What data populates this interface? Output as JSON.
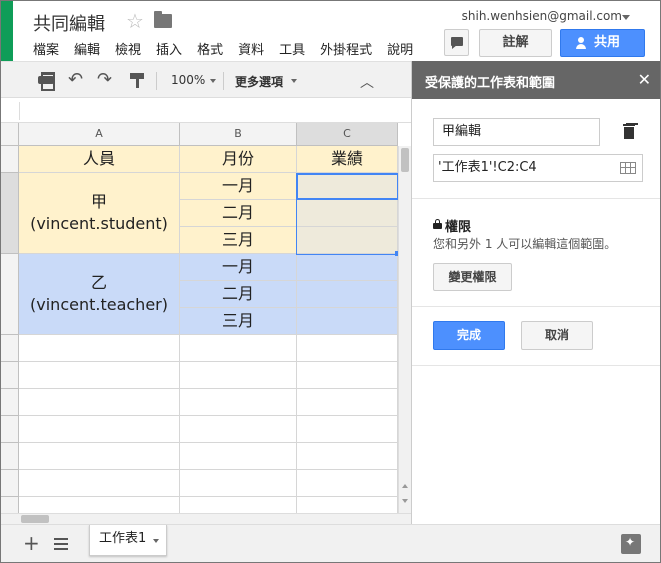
{
  "header": {
    "title": "共同編輯",
    "account": "shih.wenhsien@gmail.com",
    "menu": [
      "檔案",
      "編輯",
      "檢視",
      "插入",
      "格式",
      "資料",
      "工具",
      "外掛程式",
      "說明"
    ],
    "notes_label": "註解",
    "share_label": "共用"
  },
  "toolbar": {
    "zoom": "100%",
    "more": "更多選項"
  },
  "sheet": {
    "columns": [
      "A",
      "B",
      "C"
    ],
    "header_row": [
      "人員",
      "月份",
      "業績"
    ],
    "group1_person": [
      "甲",
      "(vincent.student)"
    ],
    "group2_person": [
      "乙",
      "(vincent.teacher)"
    ],
    "months": [
      "一月",
      "二月",
      "三月"
    ],
    "colors": {
      "group1": "#fff2cc",
      "group2": "#c9daf8",
      "selection": "#4285f4"
    }
  },
  "sheetbar": {
    "tab_label": "工作表1"
  },
  "panel": {
    "title": "受保護的工作表和範圍",
    "description": "甲編輯",
    "range": "'工作表1'!C2:C4",
    "permissions_heading": "權限",
    "permissions_text": "您和另外 1 人可以編輯這個範圍。",
    "change_button": "變更權限",
    "done_button": "完成",
    "cancel_button": "取消"
  }
}
